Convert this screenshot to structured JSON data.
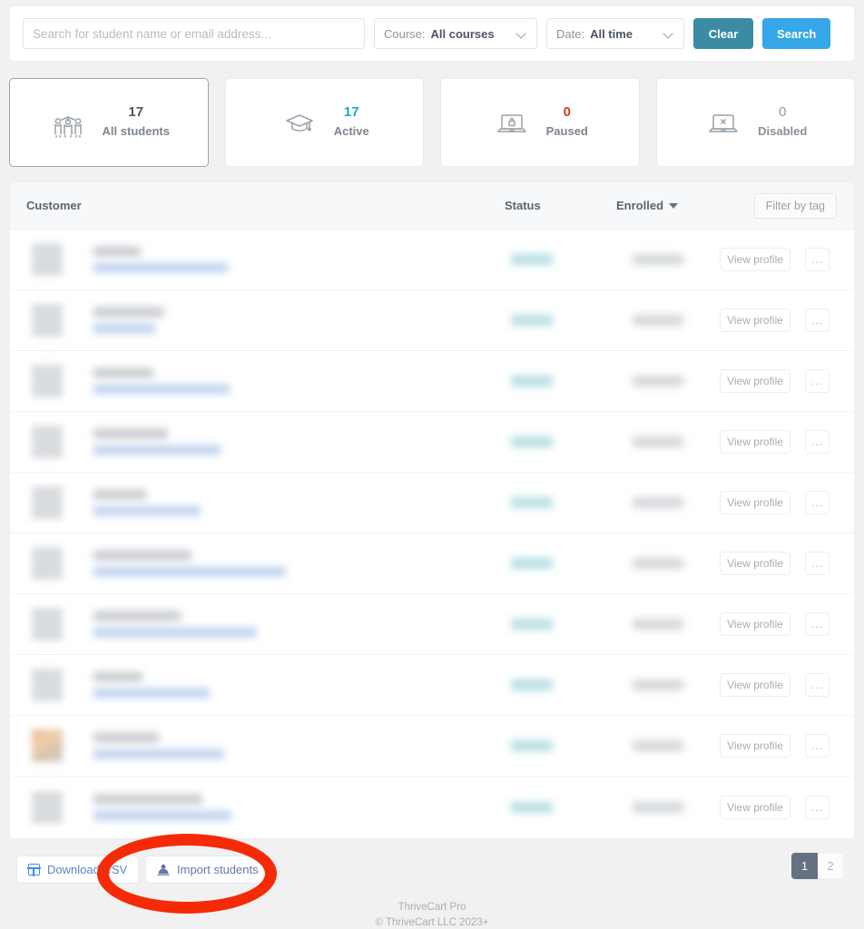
{
  "search": {
    "placeholder": "Search for student name or email address...",
    "value": "",
    "course_label": "Course:",
    "course_value": "All courses",
    "date_label": "Date:",
    "date_value": "All time",
    "clear_label": "Clear",
    "search_label": "Search"
  },
  "stats": [
    {
      "count": "17",
      "label": "All students",
      "icon": "students-group-icon",
      "selected": true,
      "tone": "default"
    },
    {
      "count": "17",
      "label": "Active",
      "icon": "graduation-cap-icon",
      "selected": false,
      "tone": "active"
    },
    {
      "count": "0",
      "label": "Paused",
      "icon": "laptop-lock-icon",
      "selected": false,
      "tone": "paused"
    },
    {
      "count": "0",
      "label": "Disabled",
      "icon": "laptop-x-icon",
      "selected": false,
      "tone": "disabled"
    }
  ],
  "table": {
    "columns": {
      "customer": "Customer",
      "status": "Status",
      "enrolled": "Enrolled"
    },
    "sort_icon": "caret-down-icon",
    "filter_by_tag": "Filter by tag",
    "row_actions": {
      "view_profile": "View profile",
      "more": "..."
    },
    "rows": [
      {
        "redacted": true,
        "avatar": "placeholder",
        "name_width": 52,
        "email_width": 148
      },
      {
        "redacted": true,
        "avatar": "placeholder",
        "name_width": 78,
        "email_width": 68
      },
      {
        "redacted": true,
        "avatar": "placeholder",
        "name_width": 66,
        "email_width": 150
      },
      {
        "redacted": true,
        "avatar": "placeholder",
        "name_width": 82,
        "email_width": 140
      },
      {
        "redacted": true,
        "avatar": "placeholder",
        "name_width": 58,
        "email_width": 118
      },
      {
        "redacted": true,
        "avatar": "placeholder",
        "name_width": 108,
        "email_width": 212
      },
      {
        "redacted": true,
        "avatar": "placeholder",
        "name_width": 96,
        "email_width": 180
      },
      {
        "redacted": true,
        "avatar": "placeholder",
        "name_width": 54,
        "email_width": 128
      },
      {
        "redacted": true,
        "avatar": "photo",
        "name_width": 72,
        "email_width": 144
      },
      {
        "redacted": true,
        "avatar": "placeholder",
        "name_width": 120,
        "email_width": 152
      }
    ]
  },
  "bottom": {
    "download_csv": "Download CSV",
    "download_csv_icon": "table-grid-icon",
    "import_students": "Import students",
    "import_students_icon": "import-user-icon",
    "pagination": {
      "pages": [
        "1",
        "2"
      ],
      "current": "1"
    }
  },
  "footer": {
    "line1": "ThriveCart Pro",
    "line2": "© ThriveCart LLC 2023+"
  },
  "annotation": {
    "shape": "ellipse",
    "color": "#f42b06",
    "targets": "import-students-button"
  },
  "colors": {
    "clear_button": "#3b8ba5",
    "search_button": "#36a7e8",
    "active_accent": "#1aa7bd",
    "paused_accent": "#d0401e",
    "annotation": "#f42b06",
    "page_background": "#f1f1f1"
  }
}
